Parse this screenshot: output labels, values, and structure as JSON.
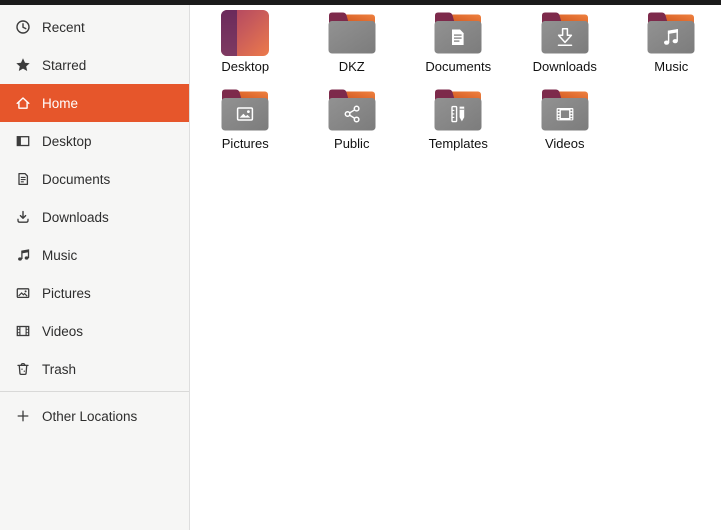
{
  "window": {
    "top_edge": "dark-toolbar-edge"
  },
  "colors": {
    "accent_selected": "#E6562B",
    "sidebar_bg": "#f6f6f5",
    "folder_body": "#868686",
    "folder_flap_orange": "#D14A12",
    "folder_tab_maroon": "#7D2A4B"
  },
  "sidebar": {
    "items": [
      {
        "label": "Recent",
        "icon": "recent-clock-icon",
        "selected": false
      },
      {
        "label": "Starred",
        "icon": "star-icon",
        "selected": false
      },
      {
        "label": "Home",
        "icon": "home-icon",
        "selected": true
      },
      {
        "label": "Desktop",
        "icon": "desktop-icon",
        "selected": false
      },
      {
        "label": "Documents",
        "icon": "documents-icon",
        "selected": false
      },
      {
        "label": "Downloads",
        "icon": "downloads-icon",
        "selected": false
      },
      {
        "label": "Music",
        "icon": "music-icon",
        "selected": false
      },
      {
        "label": "Pictures",
        "icon": "pictures-icon",
        "selected": false
      },
      {
        "label": "Videos",
        "icon": "videos-icon",
        "selected": false
      },
      {
        "label": "Trash",
        "icon": "trash-icon",
        "selected": false
      }
    ],
    "footer_item": {
      "label": "Other Locations",
      "icon": "plus-icon"
    }
  },
  "files": {
    "items": [
      {
        "label": "Desktop",
        "icon": "desktop-gradient-icon"
      },
      {
        "label": "DKZ",
        "icon": "folder-plain-icon"
      },
      {
        "label": "Documents",
        "icon": "folder-document-icon"
      },
      {
        "label": "Downloads",
        "icon": "folder-download-icon"
      },
      {
        "label": "Music",
        "icon": "folder-music-icon"
      },
      {
        "label": "Pictures",
        "icon": "folder-picture-icon"
      },
      {
        "label": "Public",
        "icon": "folder-share-icon"
      },
      {
        "label": "Templates",
        "icon": "folder-template-icon"
      },
      {
        "label": "Videos",
        "icon": "folder-video-icon"
      }
    ]
  }
}
